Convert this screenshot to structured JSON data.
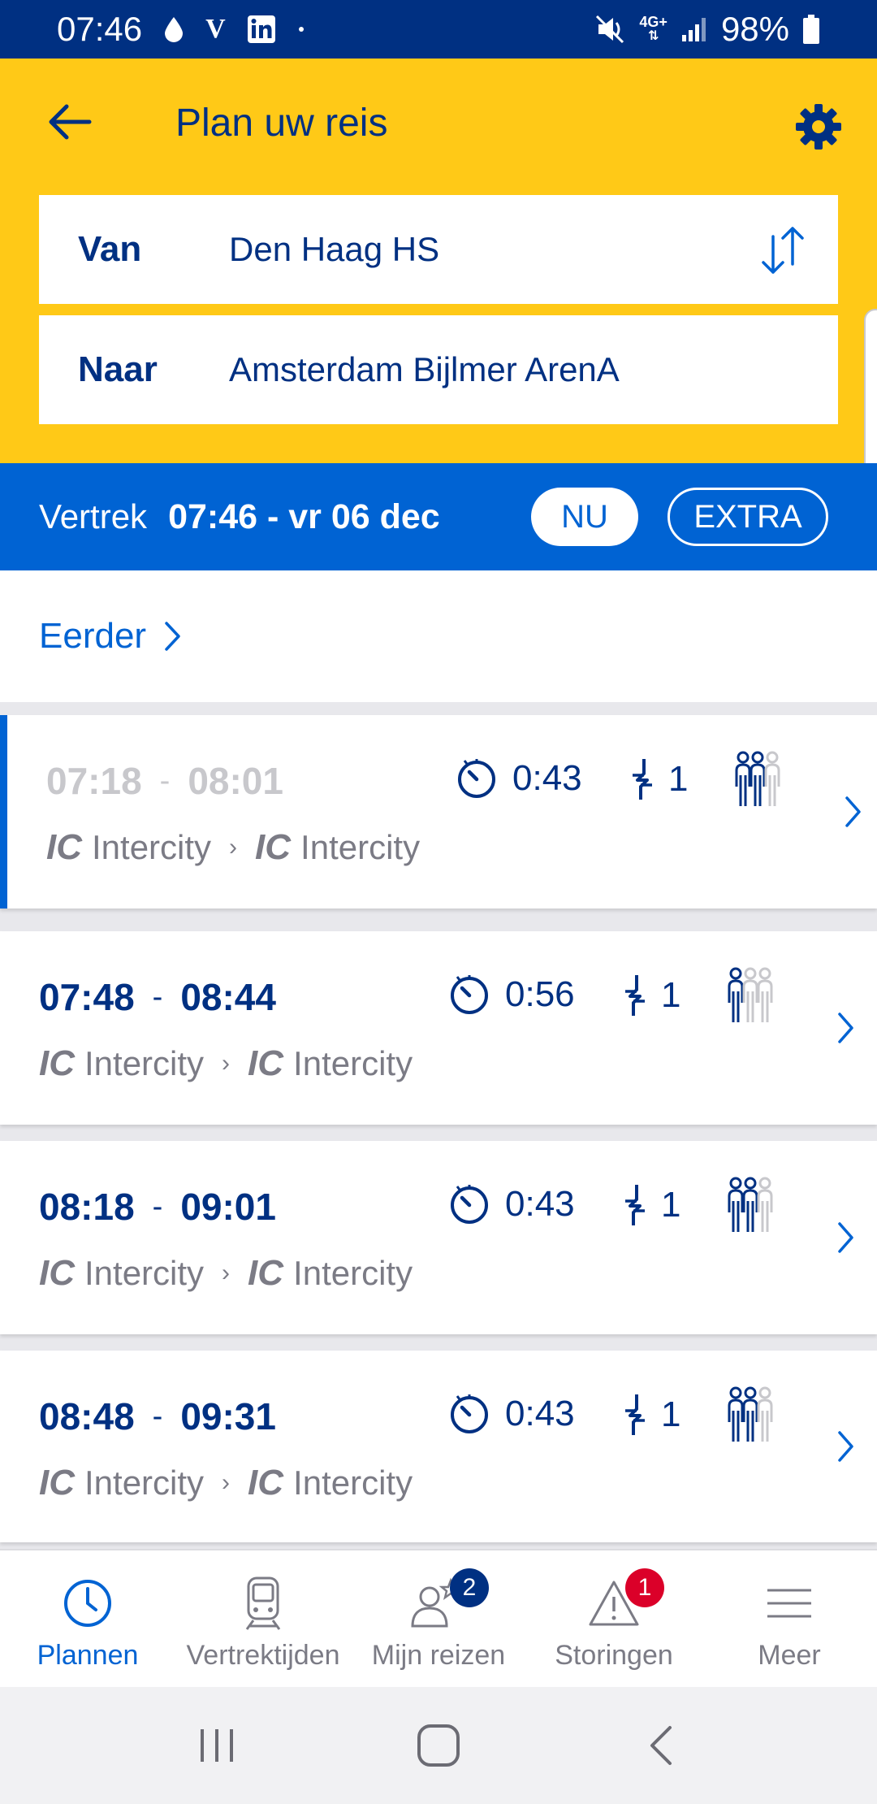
{
  "status_bar": {
    "time": "07:46",
    "battery": "98%",
    "network": "4G+"
  },
  "header": {
    "title": "Plan uw reis",
    "from_label": "Van",
    "from_value": "Den Haag HS",
    "to_label": "Naar",
    "to_value": "Amsterdam Bijlmer ArenA"
  },
  "departure": {
    "label": "Vertrek",
    "datetime": "07:46 - vr 06 dec",
    "now_button": "NU",
    "extra_button": "EXTRA"
  },
  "earlier": {
    "label": "Eerder"
  },
  "trips": [
    {
      "depart": "07:18",
      "arrive": "08:01",
      "duration": "0:43",
      "transfers": "1",
      "leg1_badge": "IC",
      "leg1_name": "Intercity",
      "leg2_badge": "IC",
      "leg2_name": "Intercity",
      "crowd_level": 2
    },
    {
      "depart": "07:48",
      "arrive": "08:44",
      "duration": "0:56",
      "transfers": "1",
      "leg1_badge": "IC",
      "leg1_name": "Intercity",
      "leg2_badge": "IC",
      "leg2_name": "Intercity",
      "crowd_level": 1
    },
    {
      "depart": "08:18",
      "arrive": "09:01",
      "duration": "0:43",
      "transfers": "1",
      "leg1_badge": "IC",
      "leg1_name": "Intercity",
      "leg2_badge": "IC",
      "leg2_name": "Intercity",
      "crowd_level": 2
    },
    {
      "depart": "08:48",
      "arrive": "09:31",
      "duration": "0:43",
      "transfers": "1",
      "leg1_badge": "IC",
      "leg1_name": "Intercity",
      "leg2_badge": "IC",
      "leg2_name": "Intercity",
      "crowd_level": 2
    }
  ],
  "bottom_nav": {
    "items": [
      {
        "label": "Plannen",
        "icon": "clock-icon"
      },
      {
        "label": "Vertrektijden",
        "icon": "train-icon"
      },
      {
        "label": "Mijn reizen",
        "icon": "person-star-icon",
        "badge": "2"
      },
      {
        "label": "Storingen",
        "icon": "warning-icon",
        "badge": "1"
      },
      {
        "label": "Meer",
        "icon": "menu-icon"
      }
    ]
  },
  "colors": {
    "ns_yellow": "#ffc917",
    "ns_dark_blue": "#003082",
    "ns_blue": "#0063d3",
    "grey_text": "#7b7b85",
    "badge_red": "#db0029"
  }
}
